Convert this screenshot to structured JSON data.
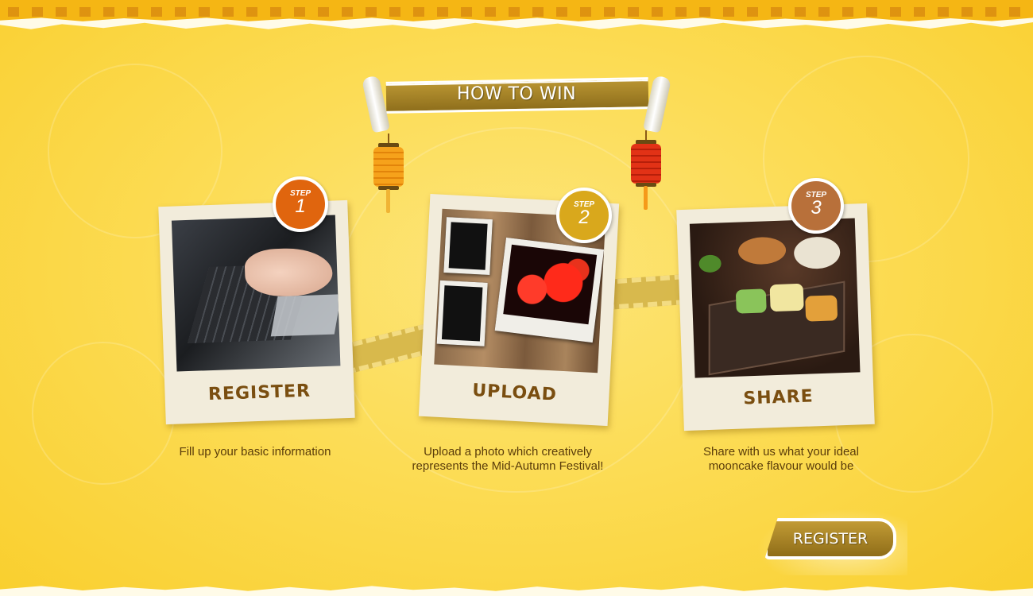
{
  "banner": {
    "title": "HOW TO WIN"
  },
  "steps": [
    {
      "step_label": "STEP",
      "number": "1",
      "title": "REGISTER",
      "description": "Fill up your basic information",
      "badge_color": "#e0650e"
    },
    {
      "step_label": "STEP",
      "number": "2",
      "title": "UPLOAD",
      "description": "Upload a photo which creatively represents the Mid-Autumn Festival!",
      "badge_color": "#d9a81c"
    },
    {
      "step_label": "STEP",
      "number": "3",
      "title": "SHARE",
      "description": "Share with us what your ideal mooncake flavour would be",
      "badge_color": "#b8703a"
    }
  ],
  "register_button": {
    "label": "REGISTER"
  },
  "colors": {
    "accent": "#a07f24",
    "background": "#fbd640",
    "text": "#5a3c0a"
  }
}
